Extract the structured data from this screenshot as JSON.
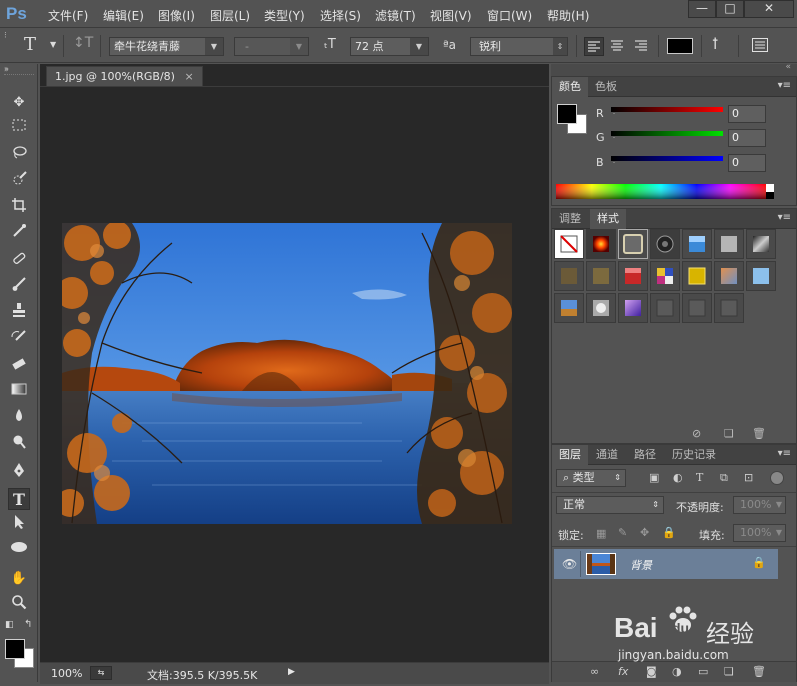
{
  "app": {
    "logo": "Ps"
  },
  "menu": [
    "文件(F)",
    "编辑(E)",
    "图像(I)",
    "图层(L)",
    "类型(Y)",
    "选择(S)",
    "滤镜(T)",
    "视图(V)",
    "窗口(W)",
    "帮助(H)"
  ],
  "window_controls": {
    "minimize": "—",
    "restore": "□",
    "close": "✕"
  },
  "options": {
    "tool_glyph": "T",
    "font_family": "牵牛花绕青藤",
    "font_style": "-",
    "font_size": "72 点",
    "aa_glyph": "ªa",
    "antialias": "锐利"
  },
  "document": {
    "tab_title": "1.jpg @ 100%(RGB/8)",
    "tab_close": "×",
    "zoom": "100%",
    "doc_info": "文档:395.5 K/395.5K",
    "play_glyph": "▶"
  },
  "color_panel": {
    "tabs": [
      "颜色",
      "色板"
    ],
    "channels": [
      {
        "label": "R",
        "value": "0"
      },
      {
        "label": "G",
        "value": "0"
      },
      {
        "label": "B",
        "value": "0"
      }
    ]
  },
  "styles_panel": {
    "tabs": [
      "调整",
      "样式"
    ]
  },
  "layers_panel": {
    "tabs": [
      "图层",
      "通道",
      "路径",
      "历史记录"
    ],
    "filter_kind": "类型",
    "blend_mode": "正常",
    "opacity_label": "不透明度:",
    "opacity_value": "100%",
    "lock_label": "锁定:",
    "fill_label": "填充:",
    "fill_value": "100%",
    "layer_name": "背景"
  },
  "watermark": {
    "brand": "Bai",
    "brand_tail": "du",
    "cn": "经验",
    "url": "jingyan.baidu.com"
  },
  "colors": {
    "accent": "#6ea4dc",
    "canvas_bg": "#282828",
    "panel_bg": "#535353",
    "layer_selected": "#6b7f98"
  },
  "icons": [
    "move-icon",
    "marquee-icon",
    "lasso-icon",
    "quick-select-icon",
    "crop-icon",
    "eyedropper-icon",
    "healing-icon",
    "brush-icon",
    "clone-stamp-icon",
    "history-brush-icon",
    "eraser-icon",
    "gradient-icon",
    "blur-icon",
    "dodge-icon",
    "pen-icon",
    "type-icon",
    "path-select-icon",
    "ellipse-icon",
    "hand-icon",
    "zoom-icon",
    "eye-icon",
    "lock-icon"
  ]
}
